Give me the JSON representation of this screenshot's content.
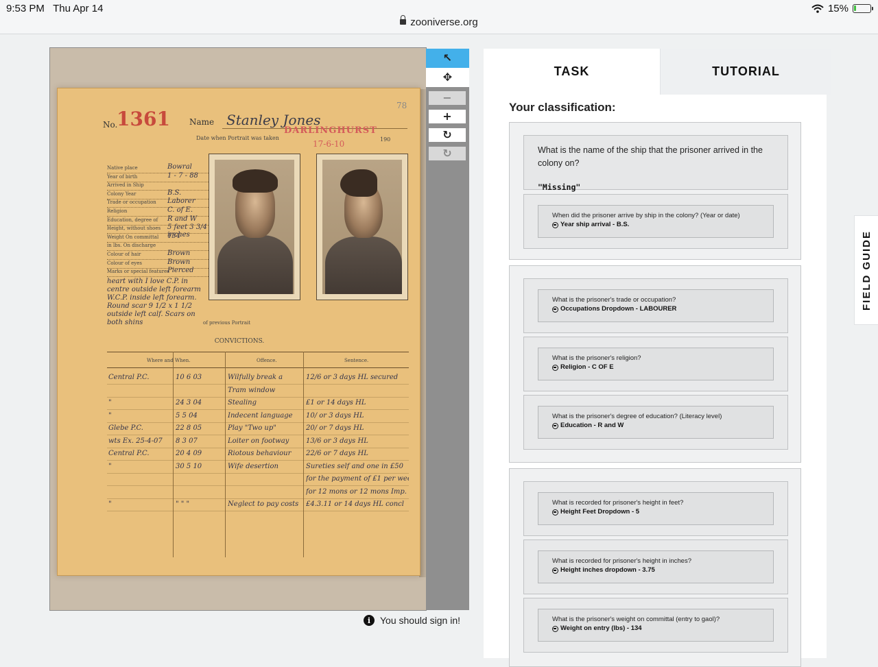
{
  "status_bar": {
    "time": "9:53 PM",
    "date": "Thu Apr 14",
    "url": "zooniverse.org",
    "battery_percent": "15%",
    "battery_level": 0.15,
    "battery_color": "#3fbf3f"
  },
  "document": {
    "no_label": "No.",
    "number": "1361",
    "page_number": "78",
    "name_label": "Name",
    "name_value": "Stanley Jones",
    "stamp": "DARLINGHURST",
    "stamp_date": "17-6-10",
    "portrait_label": "Date when Portrait was taken",
    "year_label": "190",
    "fields": [
      {
        "label": "Native place",
        "value": "Bowral"
      },
      {
        "label": "Year of birth",
        "value": "1 - 7 - 88"
      },
      {
        "label": "Arrived in Ship",
        "value": ""
      },
      {
        "label": "Colony Year",
        "value": "B.S."
      },
      {
        "label": "Trade or occupation",
        "value": "Laborer"
      },
      {
        "label": "Religion",
        "value": "C. of E."
      },
      {
        "label": "Education, degree of",
        "value": "R and W"
      },
      {
        "label": "Height, without shoes",
        "value": "5 feet 3 3/4 inches"
      },
      {
        "label": "Weight On committal",
        "value": "134"
      },
      {
        "label": "in lbs. On discharge",
        "value": ""
      },
      {
        "label": "Colour of hair",
        "value": "Brown"
      },
      {
        "label": "Colour of eyes",
        "value": "Brown"
      },
      {
        "label": "Marks or special features",
        "value": "Pierced"
      }
    ],
    "marks_text": "heart with I love C.P. in centre outside left forearm W.C.P. inside left forearm. Round scar 9 1/2 x 1 1/2 outside left calf. Scars on both shins",
    "previous_portrait_label": "of previous Portrait",
    "convictions_title": "CONVICTIONS.",
    "conv_headers": [
      "Where and When.",
      "Offence.",
      "Sentence."
    ],
    "convictions": [
      {
        "where": "Central P.C.",
        "date": "10  6  03",
        "offence": "Wilfully break a",
        "sentence": "12/6 or 3 days HL secured"
      },
      {
        "where": "",
        "date": "",
        "offence": "Tram window",
        "sentence": ""
      },
      {
        "where": "\"",
        "date": "24  3  04",
        "offence": "Stealing",
        "sentence": "£1 or 14 days HL"
      },
      {
        "where": "\"",
        "date": "5  5  04",
        "offence": "Indecent language",
        "sentence": "10/ or 3 days HL"
      },
      {
        "where": "Glebe P.C.",
        "date": "22  8  05",
        "offence": "Play \"Two up\"",
        "sentence": "20/ or 7 days HL"
      },
      {
        "where": "wts Ex. 25-4-07",
        "date": "8  3  07",
        "offence": "Loiter on footway",
        "sentence": "13/6 or 3 days HL"
      },
      {
        "where": "Central P.C.",
        "date": "20  4  09",
        "offence": "Riotous behaviour",
        "sentence": "22/6 or 7 days HL"
      },
      {
        "where": "\"",
        "date": "30  5  10",
        "offence": "Wife desertion",
        "sentence": "Sureties self and one in £50"
      },
      {
        "where": "",
        "date": "",
        "offence": "",
        "sentence": "for the payment of £1 per week"
      },
      {
        "where": "",
        "date": "",
        "offence": "",
        "sentence": "for 12 mons or 12 mons Imp."
      },
      {
        "where": "\"",
        "date": "\"  \"  \"",
        "offence": "Neglect to pay costs",
        "sentence": "£4.3.11 or 14 days HL concl"
      }
    ]
  },
  "toolbar": {
    "pointer": "↖",
    "move": "✥",
    "zoom_out": "−",
    "zoom_in": "+",
    "rotate": "↻",
    "reset": "↻",
    "accent": "#43b0ea"
  },
  "signin": {
    "info_glyph": "i",
    "text": "You should sign in!"
  },
  "task_panel": {
    "tab_task": "TASK",
    "tab_tutorial": "TUTORIAL",
    "heading": "Your classification:",
    "ship_question": "What is the name of the ship that the prisoner arrived in the colony on?",
    "ship_answer": "\"Missing\"",
    "groups": [
      {
        "items": [
          {
            "question": "When did the prisoner arrive by ship in the colony? (Year or date)",
            "answer": "Year ship arrival - B.S."
          }
        ]
      },
      {
        "items": [
          {
            "question": "What is the prisoner's trade or occupation?",
            "answer": "Occupations Dropdown - LABOURER"
          },
          {
            "question": "What is the prisoner's religion?",
            "answer": "Religion - C OF E"
          },
          {
            "question": "What is the prisoner's degree of education? (Literacy level)",
            "answer": "Education - R and W"
          }
        ]
      },
      {
        "items": [
          {
            "question": "What is recorded for prisoner's height in feet?",
            "answer": "Height Feet Dropdown - 5"
          },
          {
            "question": "What is recorded for prisoner's height in inches?",
            "answer": "Height inches dropdown - 3.75"
          },
          {
            "question": "What is the prisoner's weight on committal (entry to gaol)?",
            "answer": "Weight on entry (lbs) - 134"
          }
        ]
      }
    ]
  },
  "field_guide": {
    "label": "FIELD GUIDE"
  }
}
